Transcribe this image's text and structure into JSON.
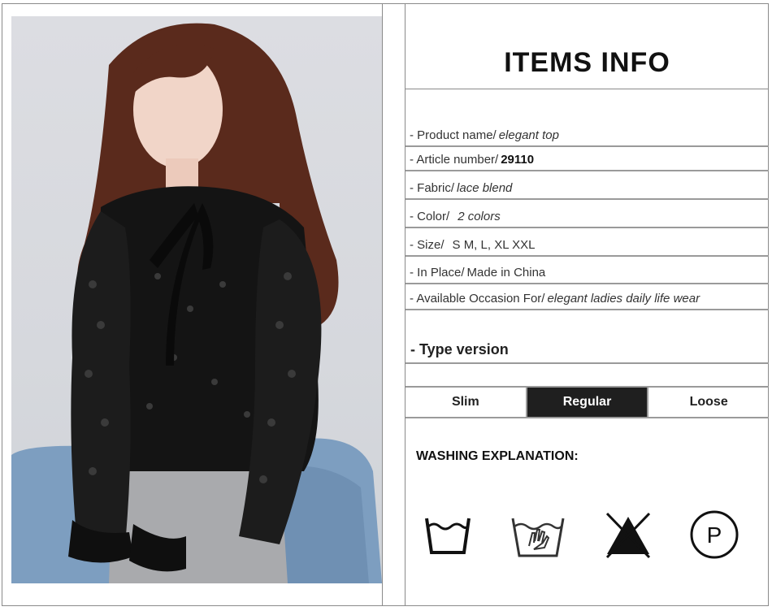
{
  "title": "ITEMS INFO",
  "specs": [
    {
      "label": "- Product name/",
      "sep": "",
      "value": "elegant top",
      "bold": false
    },
    {
      "label": "- Article number/",
      "sep": "",
      "value": "29110",
      "bold": true
    },
    {
      "label": "- Fabric/",
      "sep": "",
      "value": "lace blend",
      "bold": false
    },
    {
      "label": "- Color/",
      "sep": "",
      "value": "2 colors",
      "bold": false
    },
    {
      "label": "- Size/",
      "sep": "",
      "value": "S M, L, XL XXL",
      "bold": false
    },
    {
      "label": "- In Place/",
      "sep": "",
      "value": "Made in China",
      "bold": false
    },
    {
      "label": "- Available Occasion For/",
      "sep": "",
      "value": "elegant ladies daily life wear",
      "bold": false
    }
  ],
  "type_version": "- Type version",
  "fits": [
    "Slim",
    "Regular",
    "Loose"
  ],
  "fit_selected": "Regular",
  "washing_title": "WASHING EXPLANATION:",
  "care_icons": [
    "machine-wash-icon",
    "hand-wash-icon",
    "do-not-bleach-icon",
    "dry-clean-p-icon"
  ],
  "care_symbol_letter": "P",
  "colors": {
    "fit_active_bg": "#1f1f1f",
    "border": "#9a9a9a"
  }
}
